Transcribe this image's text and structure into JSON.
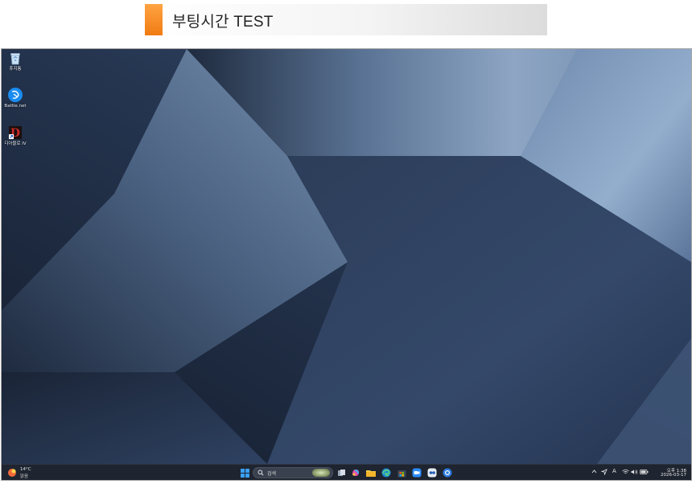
{
  "banner": {
    "title": "부팅시간 TEST"
  },
  "desktop": {
    "icons": [
      {
        "label": "휴지통",
        "icon": "recycle-bin-icon"
      },
      {
        "label": "Battle.net",
        "icon": "battlenet-icon"
      },
      {
        "label": "디아블로 IV",
        "icon": "diablo-icon"
      }
    ]
  },
  "taskbar": {
    "weather": {
      "temp": "14°C",
      "condition": "맑음",
      "icon": "weather-sun-icon"
    },
    "search": {
      "placeholder": "검색"
    },
    "pinned": [
      "start-icon",
      "task-view-icon",
      "copilot-icon",
      "file-explorer-icon",
      "edge-icon",
      "store-icon",
      "zoom-icon",
      "teams-icon",
      "chrome-icon"
    ],
    "tray": {
      "ime": "A",
      "clock_time": "오후 1:38",
      "clock_date": "2026-03-17"
    }
  },
  "colors": {
    "banner_accent": "#f07b12",
    "taskbar_bg": "#1f2530",
    "wallpaper_dark": "#172132",
    "wallpaper_light": "#8ea6c4"
  }
}
